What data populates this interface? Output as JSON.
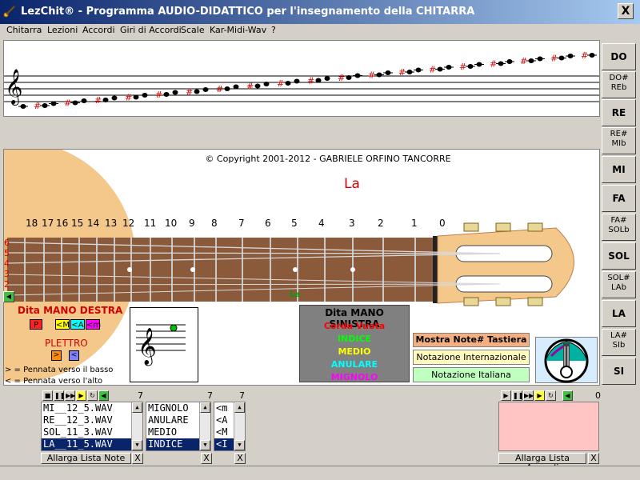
{
  "window": {
    "title": "LezChit® - Programma AUDIO-DIDATTICO per l'insegnamento della CHITARRA",
    "close_label": "X"
  },
  "menu": [
    "Chitarra",
    "Lezioni",
    "Accordi",
    "Giri di Accordi",
    "Scale",
    "Kar-Midi-Wav",
    "?"
  ],
  "note_buttons": [
    {
      "label": "DO"
    },
    {
      "label": "DO#",
      "label2": "REb"
    },
    {
      "label": "RE"
    },
    {
      "label": "RE#",
      "label2": "MIb"
    },
    {
      "label": "MI"
    },
    {
      "label": "FA"
    },
    {
      "label": "FA#",
      "label2": "SOLb"
    },
    {
      "label": "SOL"
    },
    {
      "label": "SOL#",
      "label2": "LAb"
    },
    {
      "label": "LA"
    },
    {
      "label": "LA#",
      "label2": "SIb"
    },
    {
      "label": "SI"
    }
  ],
  "staff": {
    "sharp_symbol": "#"
  },
  "main": {
    "copyright": "© Copyright 2001-2012 - GABRIELE ORFINO TANCORRE",
    "current_note": "La",
    "fret_numbers": [
      "18",
      "17",
      "16",
      "15",
      "14",
      "13",
      "12",
      "11",
      "10",
      "9",
      "8",
      "7",
      "6",
      "5",
      "4",
      "3",
      "2",
      "1",
      "0"
    ],
    "string_numbers": [
      "6",
      "5",
      "4",
      "3",
      "2",
      "1"
    ],
    "fret_note_label": "La"
  },
  "right_hand": {
    "title": "Dita MANO DESTRA",
    "fingers": [
      {
        "label": "P",
        "color": "#ff2020"
      },
      {
        "label": "<M",
        "color": "#ffff00"
      },
      {
        "label": "<A",
        "color": "#00ffff"
      },
      {
        "label": "<m",
        "color": "#ff00ff"
      }
    ],
    "plettro_label": "PLETTRO",
    "pick_down": ">",
    "pick_up": "<",
    "pennata_down": "> = Pennata verso il basso",
    "pennata_up": "< = Pennata verso l'alto"
  },
  "left_hand": {
    "title": "Dita MANO SINISTRA",
    "items": [
      {
        "label": "Corda Vuota",
        "color": "#ff0000"
      },
      {
        "label": "INDICE",
        "color": "#00ff00"
      },
      {
        "label": "MEDIO",
        "color": "#ffff00"
      },
      {
        "label": "ANULARE",
        "color": "#00ffff"
      },
      {
        "label": "MIGNOLO",
        "color": "#ff00ff"
      }
    ]
  },
  "buttons": {
    "show_notes": "Mostra Note# Tastiera",
    "int_notation": "Notazione Internazionale",
    "ita_notation": "Notazione Italiana"
  },
  "lists": {
    "wav": {
      "count": "7",
      "items": [
        "MI__12_5.WAV",
        "RE__12_3.WAV",
        "SOL_11_3.WAV",
        "LA__11_5.WAV"
      ],
      "selected": 3
    },
    "left": {
      "count": "7",
      "items": [
        "MIGNOLO",
        "ANULARE",
        "MEDIO",
        "INDICE"
      ],
      "selected": 3
    },
    "right": {
      "count": "7",
      "items": [
        "<m",
        "<A",
        "<M",
        "<I"
      ],
      "selected": 3
    },
    "chords": {
      "count": "0"
    }
  },
  "bottom": {
    "enlarge_notes": "Allarga Lista Note",
    "enlarge_chords": "Allarga Lista Accordi",
    "close": "X"
  },
  "transport": [
    "stop",
    "pause",
    "forward",
    "play",
    "repeat",
    "back"
  ]
}
